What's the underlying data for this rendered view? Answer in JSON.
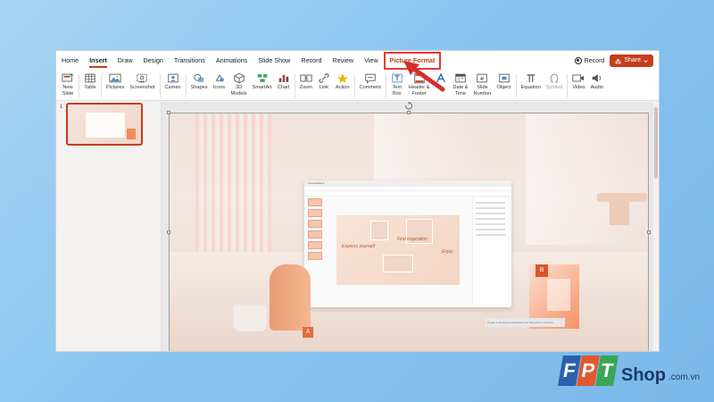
{
  "menubar": {
    "tabs": [
      {
        "label": "Home"
      },
      {
        "label": "Insert",
        "active": true
      },
      {
        "label": "Draw"
      },
      {
        "label": "Design"
      },
      {
        "label": "Transitions"
      },
      {
        "label": "Animations"
      },
      {
        "label": "Slide Show"
      },
      {
        "label": "Record"
      },
      {
        "label": "Review"
      },
      {
        "label": "View"
      },
      {
        "label": "Picture Format",
        "highlighted": true
      }
    ],
    "record_label": "Record",
    "share_label": "Share"
  },
  "ribbon": {
    "buttons": [
      {
        "label": "New\nSlide",
        "icon": "new-slide-icon"
      },
      {
        "label": "Table",
        "icon": "table-icon"
      },
      {
        "label": "Pictures",
        "icon": "pictures-icon"
      },
      {
        "label": "Screenshot",
        "icon": "screenshot-icon"
      },
      {
        "label": "Cameo",
        "icon": "cameo-icon"
      },
      {
        "label": "Shapes",
        "icon": "shapes-icon"
      },
      {
        "label": "Icons",
        "icon": "icons-icon"
      },
      {
        "label": "3D\nModels",
        "icon": "3d-models-icon"
      },
      {
        "label": "SmartArt",
        "icon": "smartart-icon"
      },
      {
        "label": "Chart",
        "icon": "chart-icon"
      },
      {
        "label": "Zoom",
        "icon": "zoom-icon"
      },
      {
        "label": "Link",
        "icon": "link-icon"
      },
      {
        "label": "Action",
        "icon": "action-icon"
      },
      {
        "label": "Comment",
        "icon": "comment-icon"
      },
      {
        "label": "Text\nBox",
        "icon": "text-box-icon"
      },
      {
        "label": "Header &\nFooter",
        "icon": "header-footer-icon"
      },
      {
        "label": "",
        "icon": "wordart-icon"
      },
      {
        "label": "Date &\nTime",
        "icon": "date-time-icon"
      },
      {
        "label": "Slide\nNumber",
        "icon": "slide-number-icon"
      },
      {
        "label": "Object",
        "icon": "object-icon"
      },
      {
        "label": "Equation",
        "icon": "equation-icon"
      },
      {
        "label": "Symbol",
        "icon": "symbol-icon",
        "disabled": true
      },
      {
        "label": "Video",
        "icon": "video-icon"
      },
      {
        "label": "Audio",
        "icon": "audio-icon"
      }
    ]
  },
  "slide_panel": {
    "slide_number": "1"
  },
  "slide": {
    "laptop_title": "Presentation1",
    "laptop_text_1": "Express yourself",
    "laptop_text_2": "Find inspiration",
    "laptop_text_3": "Enjoy",
    "prompt_text": "Create a 10 slide presentation from this photo collection",
    "box_letter": "B",
    "app_icon_letter": "A"
  },
  "logo": {
    "brand": "FPT",
    "shop": "Shop",
    "domain": ".com.vn"
  },
  "colors": {
    "accent": "#c43e1c",
    "highlight_border": "#e53935",
    "background": "#86c3ef",
    "logo_f": "#2b5fad",
    "logo_p": "#e4572e",
    "logo_t": "#3aa655"
  }
}
